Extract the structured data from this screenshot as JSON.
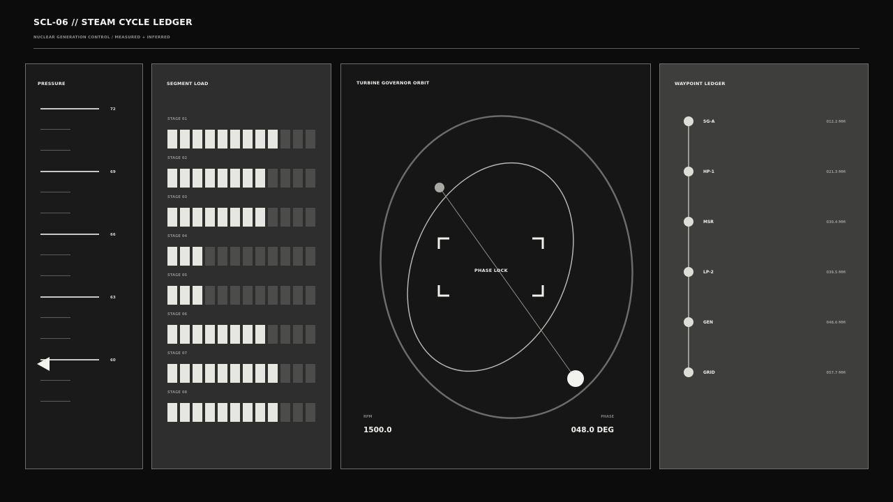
{
  "header": {
    "title": "SCL-06 // STEAM CYCLE LEDGER",
    "subtitle": "NUCLEAR GENERATION CONTROL / MEASURED + INFERRED"
  },
  "pressure": {
    "title": "PRESSURE",
    "labels": [
      "72",
      "69",
      "66",
      "63",
      "60"
    ],
    "pointer_value": 60
  },
  "segment_load": {
    "title": "SEGMENT LOAD",
    "segments_per_stage": 12,
    "stages": [
      {
        "label": "STAGE 01",
        "active": 9
      },
      {
        "label": "STAGE 02",
        "active": 8
      },
      {
        "label": "STAGE 03",
        "active": 8
      },
      {
        "label": "STAGE 04",
        "active": 3
      },
      {
        "label": "STAGE 05",
        "active": 3
      },
      {
        "label": "STAGE 06",
        "active": 8
      },
      {
        "label": "STAGE 07",
        "active": 9
      },
      {
        "label": "STAGE 08",
        "active": 9
      }
    ]
  },
  "turbine": {
    "title": "TURBINE GOVERNOR ORBIT",
    "center_label": "PHASE LOCK",
    "rpm_label": "RPM",
    "rpm_value": "1500.0",
    "phase_label": "PHASE",
    "phase_value": "048.0 DEG"
  },
  "waypoints": {
    "title": "WAYPOINT LEDGER",
    "items": [
      {
        "name": "SG-A",
        "value": "012.2 MM"
      },
      {
        "name": "HP-1",
        "value": "021.3 MM"
      },
      {
        "name": "MSR",
        "value": "030.4 MM"
      },
      {
        "name": "LP-2",
        "value": "039.5 MM"
      },
      {
        "name": "GEN",
        "value": "048.6 MM"
      },
      {
        "name": "GRID",
        "value": "057.7 MM"
      }
    ]
  },
  "colors": {
    "background": "#0b0c0b",
    "segment_on": "#e6e6e2",
    "segment_off": "#4c4d4b"
  }
}
